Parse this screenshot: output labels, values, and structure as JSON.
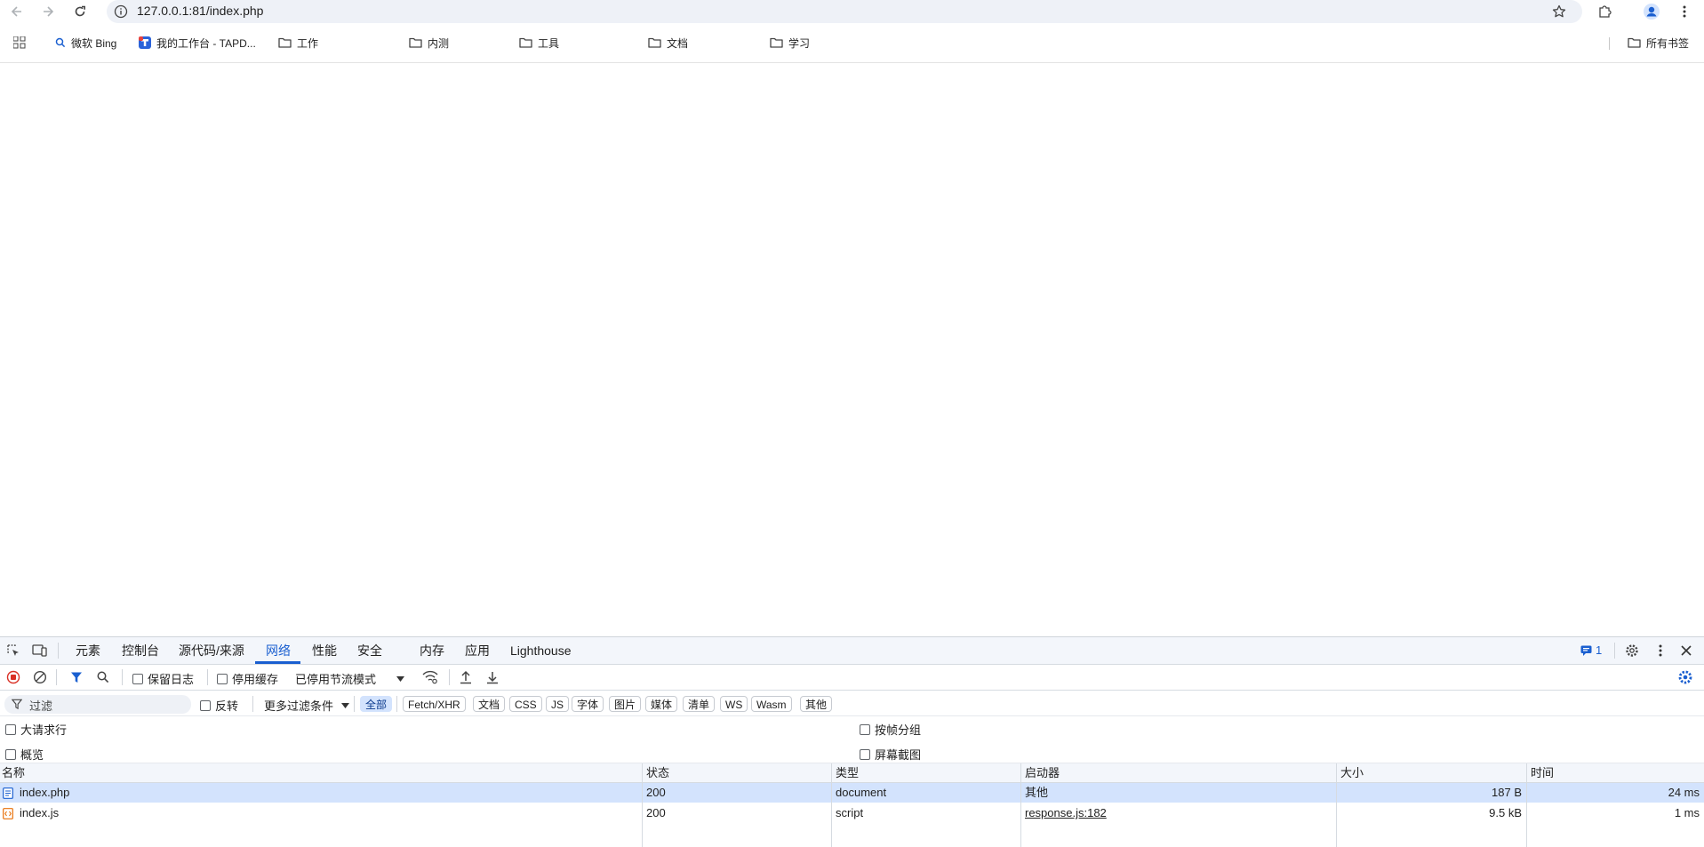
{
  "browser": {
    "url": "127.0.0.1:81/index.php",
    "bookmarks": [
      {
        "label": "微软 Bing",
        "icon": "search-icon"
      },
      {
        "label": "我的工作台 - TAPD...",
        "icon": "tapd-logo-icon"
      },
      {
        "label": "工作",
        "icon": "folder-icon"
      },
      {
        "label": "内测",
        "icon": "folder-icon"
      },
      {
        "label": "工具",
        "icon": "folder-icon"
      },
      {
        "label": "文档",
        "icon": "folder-icon"
      },
      {
        "label": "学习",
        "icon": "folder-icon"
      }
    ],
    "all_bookmarks_label": "所有书签"
  },
  "devtools": {
    "tabs": [
      "元素",
      "控制台",
      "源代码/来源",
      "网络",
      "性能",
      "安全",
      "内存",
      "应用",
      "Lighthouse"
    ],
    "active_tab": "网络",
    "issues_count": "1",
    "toolbar": {
      "preserve_log": "保留日志",
      "disable_cache": "停用缓存",
      "throttling": "已停用节流模式"
    },
    "filter": {
      "placeholder": "过滤",
      "invert": "反转",
      "more_filters": "更多过滤条件",
      "types": [
        "全部",
        "Fetch/XHR",
        "文档",
        "CSS",
        "JS",
        "字体",
        "图片",
        "媒体",
        "清单",
        "WS",
        "Wasm",
        "其他"
      ],
      "active_type": "全部"
    },
    "options": {
      "big_request_rows": "大请求行",
      "group_by_frame": "按帧分组",
      "overview": "概览",
      "screenshots": "屏幕截图"
    },
    "table": {
      "headers": [
        "名称",
        "状态",
        "类型",
        "启动器",
        "大小",
        "时间"
      ],
      "rows": [
        {
          "name": "index.php",
          "status": "200",
          "type": "document",
          "initiator": "其他",
          "size": "187 B",
          "time": "24 ms",
          "icon": "document-file-icon",
          "selected": true
        },
        {
          "name": "index.js",
          "status": "200",
          "type": "script",
          "initiator": "response.js:182",
          "size": "9.5 kB",
          "time": "1 ms",
          "icon": "script-file-icon",
          "selected": false
        }
      ]
    }
  },
  "colors": {
    "accent": "#1a5fd0",
    "selected_row": "#d3e3fd",
    "record_red": "#d93025"
  }
}
